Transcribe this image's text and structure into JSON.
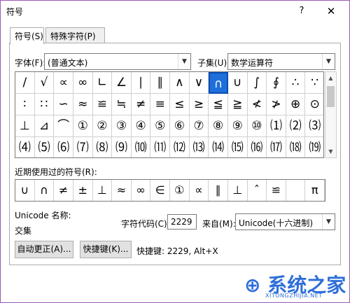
{
  "window": {
    "title": "符号",
    "help": "?",
    "close": "✕"
  },
  "tabs": [
    {
      "label": "符号(S)"
    },
    {
      "label": "特殊字符(P)"
    }
  ],
  "font": {
    "label": "字体(F):",
    "value": "(普通文本)"
  },
  "subset": {
    "label": "子集(U):",
    "value": "数学运算符"
  },
  "symbols_grid": [
    [
      "/",
      "√",
      "∝",
      "∞",
      "∟",
      "∠",
      "∣",
      "∥",
      "∧",
      "∨",
      "∩",
      "∪",
      "∫",
      "∮",
      "∴",
      "∵"
    ],
    [
      "∶",
      "∷",
      "∽",
      "≈",
      "≌",
      "≒",
      "≠",
      "≡",
      "≤",
      "≥",
      "≦",
      "≧",
      "≮",
      "≯",
      "⊕",
      "⊙"
    ],
    [
      "⊥",
      "⊿",
      "⌒",
      "①",
      "②",
      "③",
      "④",
      "⑤",
      "⑥",
      "⑦",
      "⑧",
      "⑨",
      "⑩",
      "⑴",
      "⑵",
      "⑶"
    ],
    [
      "⑷",
      "⑸",
      "⑹",
      "⑺",
      "⑻",
      "⑼",
      "⑽",
      "⑾",
      "⑿",
      "⒀",
      "⒁",
      "⒂",
      "⒃",
      "⒄",
      "⒅",
      "⒆"
    ]
  ],
  "selected_symbol": "∩",
  "recent": {
    "label": "近期使用过的符号(R):",
    "symbols": [
      "∪",
      "∩",
      "≠",
      "±",
      "⊥",
      "≈",
      "∞",
      "∈",
      "①",
      "∝",
      "∥",
      "⊥",
      "ˆ",
      "≌",
      "",
      "π"
    ]
  },
  "unicode": {
    "label": "Unicode 名称:",
    "name": "交集"
  },
  "char_code": {
    "label": "字符代码(C):",
    "value": "2229"
  },
  "from": {
    "label": "来自(M):",
    "value": "Unicode(十六进制)"
  },
  "buttons": {
    "autocorrect": "自动更正(A)...",
    "shortcut": "快捷键(K)..."
  },
  "shortcut_text": "快捷键: 2229, Alt+X",
  "watermark": {
    "logo": "系统之家",
    "url": "XITONGZHIJIA.NET"
  }
}
